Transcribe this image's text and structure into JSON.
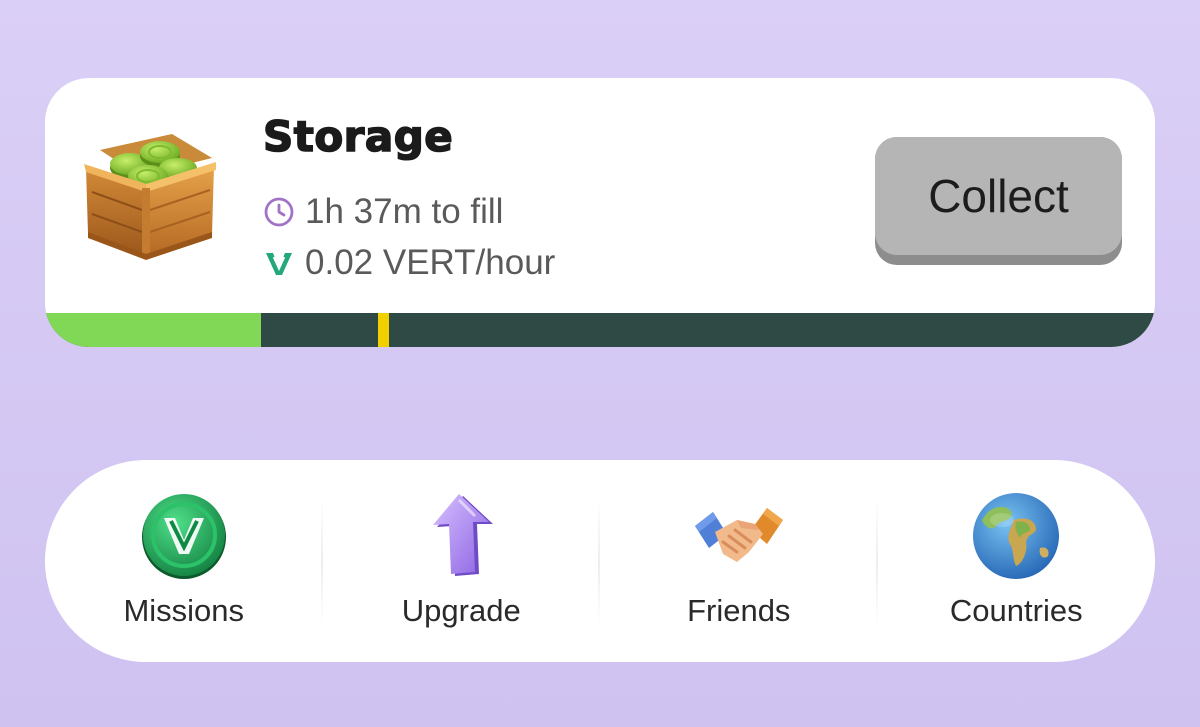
{
  "storage": {
    "title": "Storage",
    "fill_time": "1h 37m to fill",
    "rate": "0.02 VERT/hour",
    "collect_label": "Collect",
    "progress_fraction": 0.195,
    "marker_fraction": 0.3,
    "icons": {
      "crate": "coin-crate-icon",
      "fill": "clock-icon",
      "rate": "vert-logo-icon"
    },
    "colors": {
      "fill": "#80d856",
      "track": "#2f4a45",
      "marker": "#f2d000",
      "clock": "#a173c6",
      "vert": "#22a87a"
    }
  },
  "nav": {
    "items": [
      {
        "label": "Missions",
        "icon": "vert-coin-icon"
      },
      {
        "label": "Upgrade",
        "icon": "up-arrow-icon"
      },
      {
        "label": "Friends",
        "icon": "handshake-icon"
      },
      {
        "label": "Countries",
        "icon": "globe-icon"
      }
    ]
  }
}
